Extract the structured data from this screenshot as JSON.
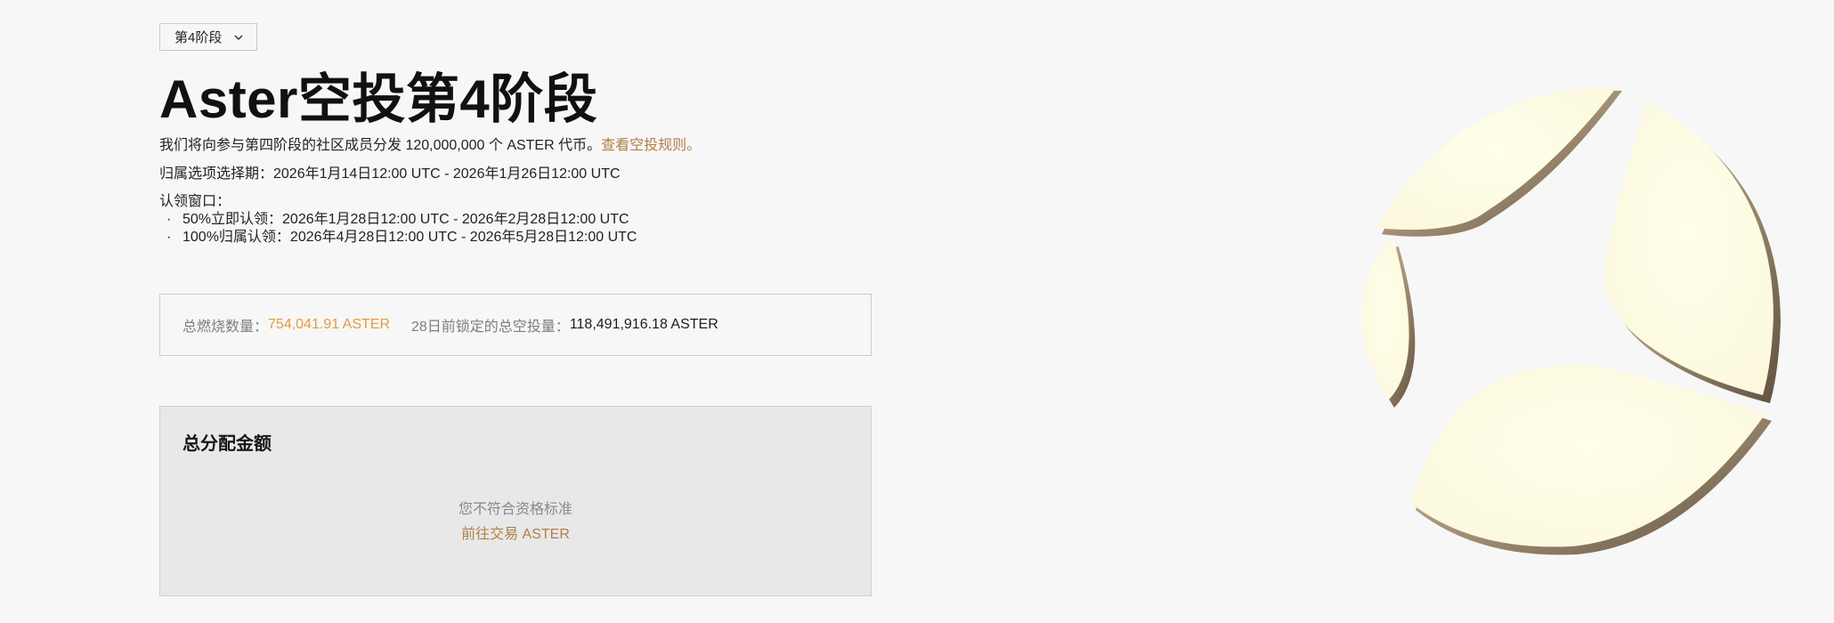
{
  "phase_selector": {
    "label": "第4阶段",
    "icon": "chevron-down-icon"
  },
  "page": {
    "title": "Aster空投第4阶段",
    "intro_text": "我们将向参与第四阶段的社区成员分发 120,000,000 个 ASTER 代币。",
    "intro_link": "查看空投规则。",
    "vesting_window": "归属选项选择期：2026年1月14日12:00 UTC - 2026年1月26日12:00 UTC",
    "claim_label": "认领窗口：",
    "claim_windows": [
      "50%立即认领：2026年1月28日12:00 UTC - 2026年2月28日12:00 UTC",
      "100%归属认领：2026年4月28日12:00 UTC - 2026年5月28日12:00 UTC"
    ],
    "bullet": "·"
  },
  "stats": {
    "burn_label": "总燃烧数量：",
    "burn_value": "754,041.91 ASTER",
    "locked_label": "28日前锁定的总空投量：",
    "locked_value": "118,491,916.18 ASTER"
  },
  "allocation": {
    "title": "总分配金额",
    "status": "您不符合资格标准",
    "action": "前往交易 ASTER"
  },
  "logo": {
    "name": "aster-logo",
    "fill": "#fffde2",
    "edge": "#8c7a62"
  }
}
